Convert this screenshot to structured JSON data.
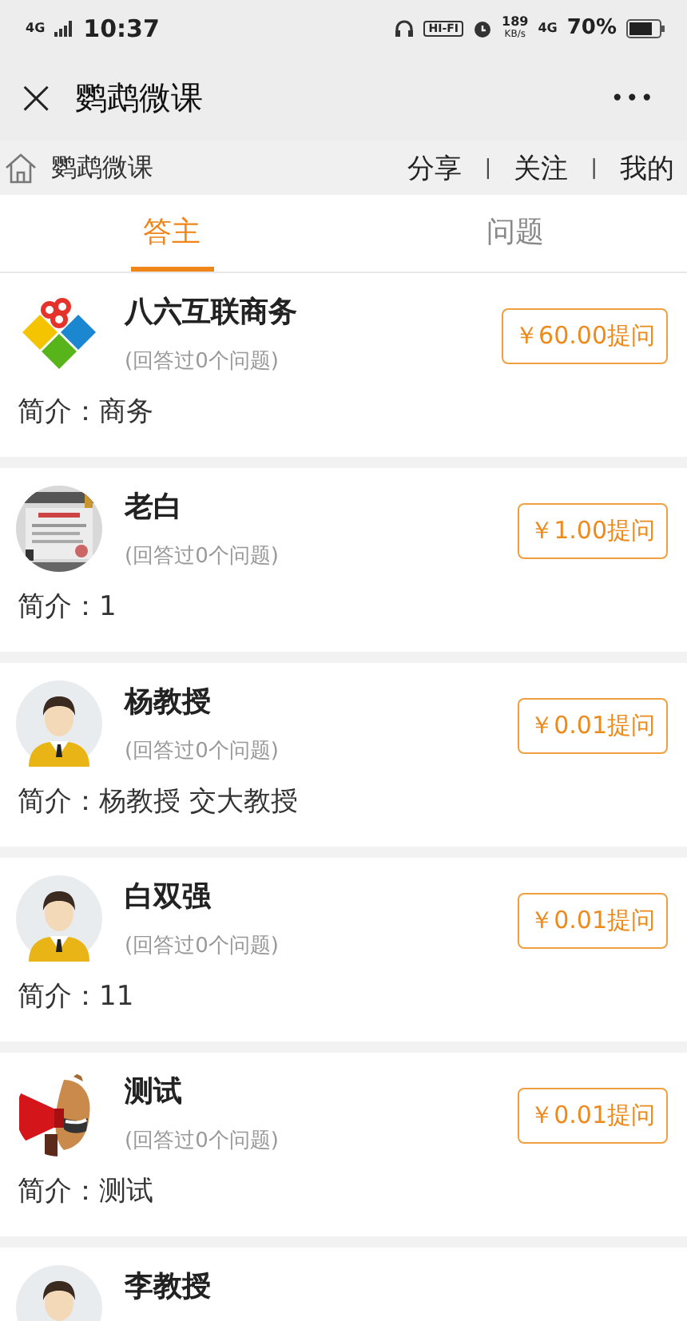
{
  "status_bar": {
    "network_left": "4G",
    "time": "10:37",
    "hifi": "HI-FI",
    "speed": "189",
    "speed_unit": "KB/s",
    "network_right": "4G",
    "battery": "70%"
  },
  "header": {
    "close": "×",
    "title": "鹦鹉微课",
    "more": "•••"
  },
  "nav": {
    "home": "鹦鹉微课",
    "links": [
      "分享",
      "关注",
      "我的"
    ],
    "separator": "|"
  },
  "tabs": [
    {
      "label": "答主",
      "selected": true
    },
    {
      "label": "问题",
      "selected": false
    }
  ],
  "experts": [
    {
      "kind": "logo",
      "name": "八六互联商务",
      "answered": "(回答过0个问题)",
      "price": "￥60.00提问",
      "intro": "简介：商务"
    },
    {
      "kind": "picture",
      "name": "老白",
      "answered": "(回答过0个问题)",
      "price": "￥1.00提问",
      "intro": "简介：1"
    },
    {
      "kind": "person",
      "name": "杨教授",
      "answered": "(回答过0个问题)",
      "price": "￥0.01提问",
      "intro": "简介：杨教授 交大教授"
    },
    {
      "kind": "person",
      "name": "白双强",
      "answered": "(回答过0个问题)",
      "price": "￥0.01提问",
      "intro": "简介：11"
    },
    {
      "kind": "mascot",
      "name": "测试",
      "answered": "(回答过0个问题)",
      "price": "￥0.01提问",
      "intro": "简介：测试"
    },
    {
      "kind": "person",
      "name": "李教授"
    }
  ]
}
